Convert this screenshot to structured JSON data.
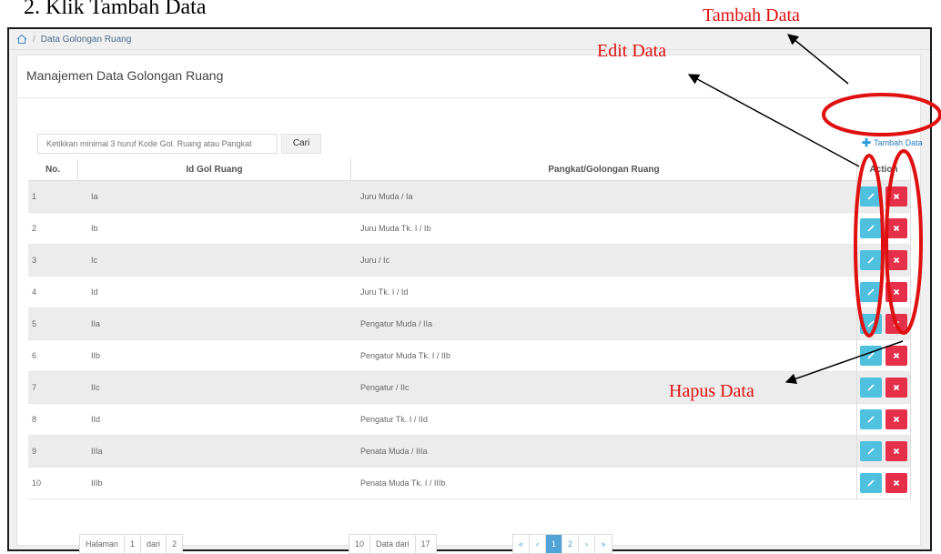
{
  "doc": {
    "heading": "2.   Klik Tambah Data"
  },
  "breadcrumb": {
    "current": "Data Golongan Ruang"
  },
  "panel": {
    "title": "Manajemen Data Golongan Ruang"
  },
  "search": {
    "placeholder": "Ketikkan minimal 3 huruf Kode Gol. Ruang atau Pangkat",
    "button": "Cari"
  },
  "add": {
    "label": "Tambah Data"
  },
  "table": {
    "headers": {
      "no": "No.",
      "id": "Id Gol Ruang",
      "pangkat": "Pangkat/Golongan Ruang",
      "action": "Action"
    },
    "rows": [
      {
        "no": "1",
        "id": "Ia",
        "pangkat": "Juru Muda / Ia"
      },
      {
        "no": "2",
        "id": "Ib",
        "pangkat": "Juru Muda Tk. I / Ib"
      },
      {
        "no": "3",
        "id": "Ic",
        "pangkat": "Juru / Ic"
      },
      {
        "no": "4",
        "id": "Id",
        "pangkat": "Juru Tk. I / Id"
      },
      {
        "no": "5",
        "id": "IIa",
        "pangkat": "Pengatur Muda / IIa"
      },
      {
        "no": "6",
        "id": "IIb",
        "pangkat": "Pengatur Muda Tk. I / IIb"
      },
      {
        "no": "7",
        "id": "IIc",
        "pangkat": "Pengatur / IIc"
      },
      {
        "no": "8",
        "id": "IId",
        "pangkat": "Pengatur Tk. I / IId"
      },
      {
        "no": "9",
        "id": "IIIa",
        "pangkat": "Penata Muda / IIIa"
      },
      {
        "no": "10",
        "id": "IIIb",
        "pangkat": "Penata Muda Tk. I / IIIb"
      }
    ]
  },
  "pager": {
    "halaman_label": "Halaman",
    "halaman_value": "1",
    "dari_label": "dari",
    "dari_value": "2",
    "per_page": "10",
    "data_dari_label": "Data dari",
    "total": "17",
    "first": "«",
    "prev": "‹",
    "page1": "1",
    "page2": "2",
    "next": "›",
    "last": "»"
  },
  "annotations": {
    "tambah": "Tambah Data",
    "edit": "Edit Data",
    "hapus": "Hapus Data",
    "color": "#e01010"
  }
}
